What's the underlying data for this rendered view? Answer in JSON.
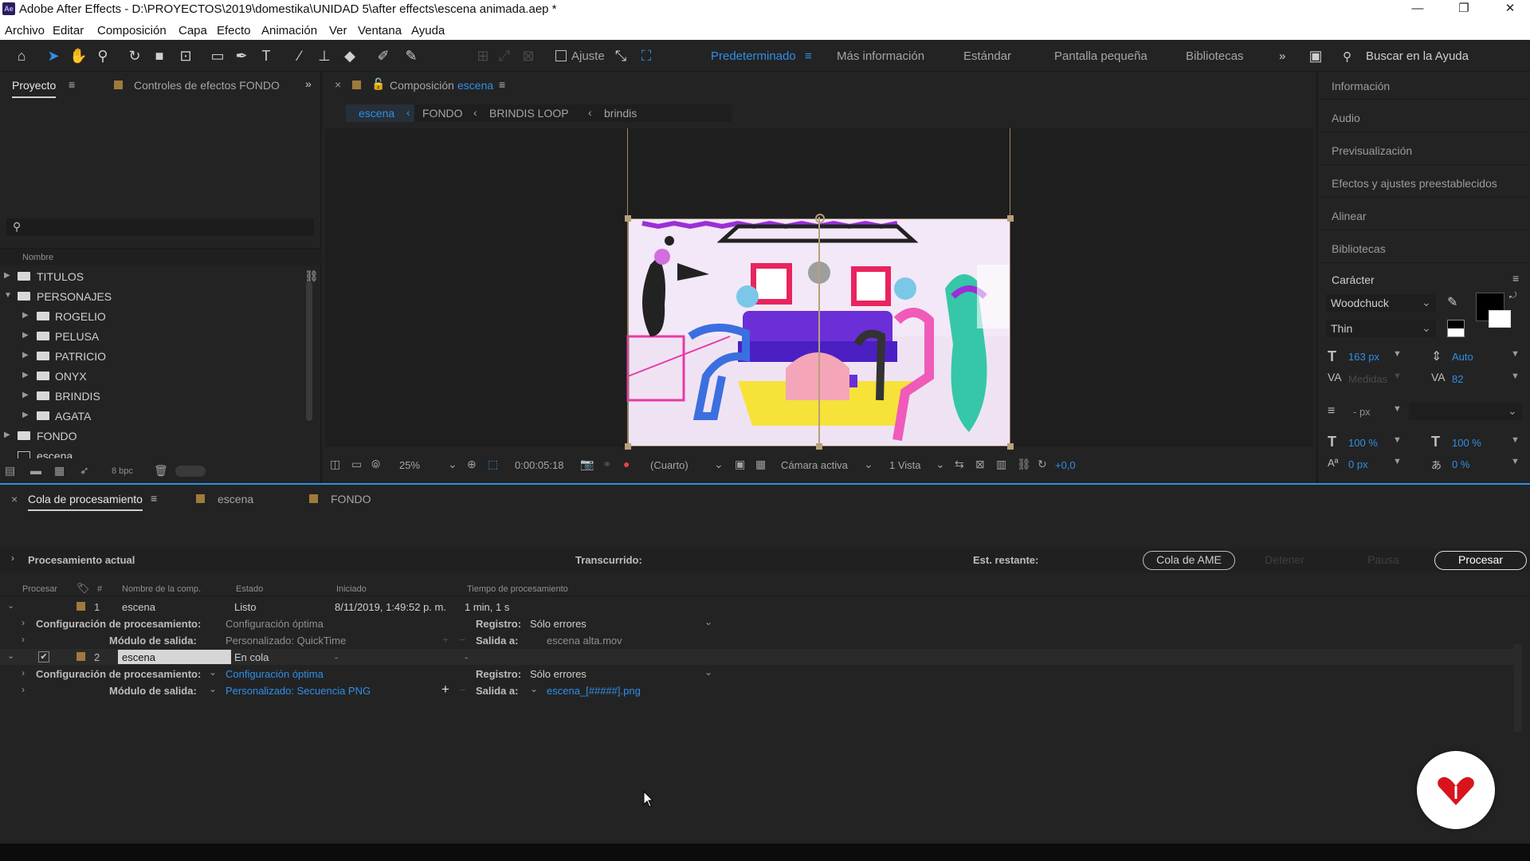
{
  "title_bar": {
    "title": "Adobe After Effects - D:\\PROYECTOS\\2019\\domestika\\UNIDAD 5\\after effects\\escena animada.aep *",
    "app_icon": "Ae"
  },
  "menu": [
    "Archivo",
    "Editar",
    "Composición",
    "Capa",
    "Efecto",
    "Animación",
    "Ver",
    "Ventana",
    "Ayuda"
  ],
  "toolbar": {
    "snap_label": "Ajuste",
    "workspaces": [
      "Predeterminado",
      "Más información",
      "Estándar",
      "Pantalla pequeña",
      "Bibliotecas"
    ],
    "help_placeholder": "Buscar en la Ayuda"
  },
  "project_panel": {
    "tab": "Proyecto",
    "effects_tab": "Controles de efectos FONDO",
    "column_name": "Nombre",
    "bpc": "8 bpc",
    "items": [
      {
        "label": "TITULOS",
        "type": "folder",
        "level": 0
      },
      {
        "label": "PERSONAJES",
        "type": "folder",
        "level": 0,
        "open": true
      },
      {
        "label": "ROGELIO",
        "type": "folder",
        "level": 1
      },
      {
        "label": "PELUSA",
        "type": "folder",
        "level": 1
      },
      {
        "label": "PATRICIO",
        "type": "folder",
        "level": 1
      },
      {
        "label": "ONYX",
        "type": "folder",
        "level": 1
      },
      {
        "label": "BRINDIS",
        "type": "folder",
        "level": 1
      },
      {
        "label": "AGATA",
        "type": "folder",
        "level": 1
      },
      {
        "label": "FONDO",
        "type": "folder",
        "level": 0
      },
      {
        "label": "escena",
        "type": "comp",
        "level": 0
      }
    ]
  },
  "comp_panel": {
    "tab_prefix": "Composición",
    "tab_name": "escena",
    "breadcrumbs": [
      "escena",
      "FONDO",
      "BRINDIS LOOP",
      "brindis"
    ],
    "zoom": "25%",
    "timecode": "0:00:05:18",
    "resolution": "(Cuarto)",
    "camera": "Cámara activa",
    "views": "1 Vista",
    "exposure": "+0,0"
  },
  "right_panel": {
    "items": [
      "Información",
      "Audio",
      "Previsualización",
      "Efectos y ajustes preestablecidos",
      "Alinear",
      "Bibliotecas"
    ],
    "character": {
      "title": "Carácter",
      "font": "Woodchuck",
      "style": "Thin",
      "size": "163 px",
      "leading": "Auto",
      "kerning": "Medidas",
      "tracking": "82",
      "stroke": "- px",
      "vscale": "100 %",
      "hscale": "100 %",
      "baseline": "0 px",
      "tsume": "0 %"
    }
  },
  "render_queue": {
    "tabs": [
      "Cola de procesamiento",
      "escena",
      "FONDO"
    ],
    "current_label": "Procesamiento actual",
    "elapsed_label": "Transcurrido:",
    "remaining_label": "Est. restante:",
    "buttons": [
      "Cola de AME",
      "Detener",
      "Pausa",
      "Procesar"
    ],
    "headers": [
      "Procesar",
      "#",
      "Nombre de la comp.",
      "Estado",
      "Iniciado",
      "Tiempo de procesamiento"
    ],
    "settings_label": "Configuración de procesamiento:",
    "output_label": "Módulo de salida:",
    "log_label": "Registro:",
    "output_to_label": "Salida a:",
    "items": [
      {
        "num": "1",
        "name": "escena",
        "status": "Listo",
        "started": "8/11/2019, 1:49:52 p. m.",
        "time": "1 min, 1 s",
        "settings": "Configuración óptima",
        "module": "Personalizado: QuickTime",
        "log": "Sólo errores",
        "output": "escena alta.mov"
      },
      {
        "num": "2",
        "name": "escena",
        "status": "En cola",
        "started": "-",
        "time": "-",
        "settings": "Configuración óptima",
        "module": "Personalizado: Secuencia PNG",
        "log": "Sólo errores",
        "output": "escena_[#####].png"
      }
    ]
  },
  "colors": {
    "accent": "#2f8fe8",
    "bg": "#232323",
    "label_orange": "#a07a3c",
    "brand_red": "#d7141e"
  }
}
